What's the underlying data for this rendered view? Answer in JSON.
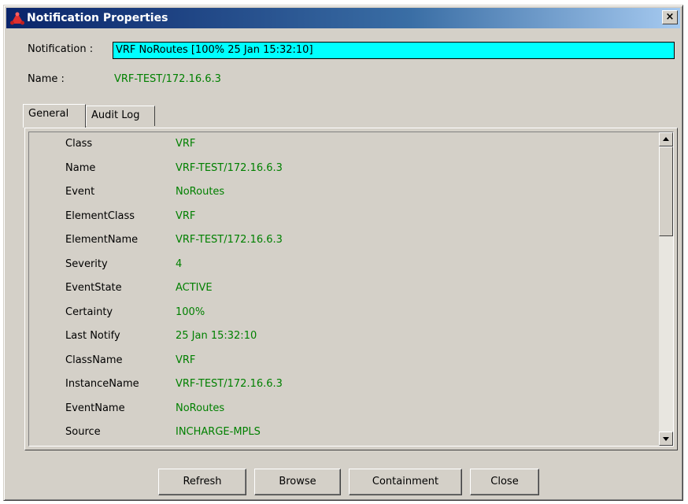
{
  "window": {
    "title": "Notification Properties",
    "close_glyph": "×",
    "icon": "smarts-logo-icon"
  },
  "header": {
    "notification_label": "Notification :",
    "notification_value": "VRF NoRoutes  [100% 25 Jan 15:32:10]",
    "name_label": "Name :",
    "name_value": "VRF-TEST/172.16.6.3",
    "highlight_color": "#00ffff",
    "value_color": "#008000"
  },
  "tabs": [
    {
      "label": "General",
      "active": true
    },
    {
      "label": "Audit Log",
      "active": false
    }
  ],
  "properties": [
    {
      "key": "Class",
      "value": "VRF"
    },
    {
      "key": "Name",
      "value": "VRF-TEST/172.16.6.3"
    },
    {
      "key": "Event",
      "value": "NoRoutes"
    },
    {
      "key": "ElementClass",
      "value": "VRF"
    },
    {
      "key": "ElementName",
      "value": "VRF-TEST/172.16.6.3"
    },
    {
      "key": "Severity",
      "value": "4"
    },
    {
      "key": "EventState",
      "value": "ACTIVE"
    },
    {
      "key": "Certainty",
      "value": "100%"
    },
    {
      "key": "Last Notify",
      "value": "25 Jan 15:32:10"
    },
    {
      "key": "ClassName",
      "value": "VRF"
    },
    {
      "key": "InstanceName",
      "value": "VRF-TEST/172.16.6.3"
    },
    {
      "key": "EventName",
      "value": "NoRoutes"
    },
    {
      "key": "Source",
      "value": "INCHARGE-MPLS"
    }
  ],
  "buttons": {
    "refresh": "Refresh",
    "browse": "Browse",
    "containment": "Containment",
    "close": "Close"
  }
}
